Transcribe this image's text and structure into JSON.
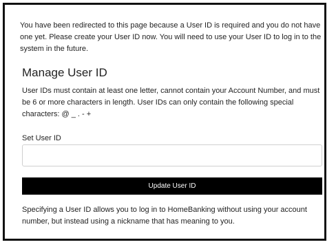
{
  "notice": {
    "text": "You have been redirected to this page because a User ID is required and you do not have one yet. Please create your User ID now. You will need to use your User ID to log in to the system in the future."
  },
  "manage": {
    "title": "Manage User ID",
    "rules": "User IDs must contain at least one letter, cannot contain your Account Number, and must be 6 or more characters in length. User IDs can only contain the following special characters: @ _ . - +"
  },
  "form": {
    "label": "Set User ID",
    "value": "",
    "button_label": "Update User ID"
  },
  "footer": {
    "text": "Specifying a User ID allows you to log in to HomeBanking without using your account number, but instead using a nickname that has meaning to you."
  }
}
